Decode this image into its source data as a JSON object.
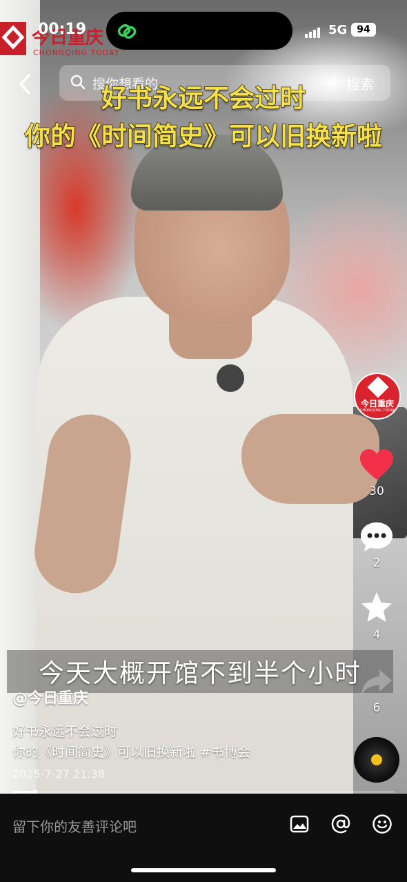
{
  "status": {
    "time": "00:19",
    "network": "5G",
    "battery": "94"
  },
  "watermark": {
    "name": "今日重庆",
    "sub": "CHONGQING TODAY"
  },
  "search": {
    "placeholder": "搜你想看的",
    "button": "搜索"
  },
  "captions": {
    "line1": "好书永远不会过时",
    "line2": "你的《时间简史》可以旧换新啦"
  },
  "subtitle": "今天大概开馆不到半个小时",
  "post": {
    "author": "@今日重庆",
    "desc_line1": "好书永远不会过时",
    "desc_line2": "你的《时间简史》可以旧换新啦 #书博会",
    "date": "2025-7-27 21:38",
    "progress": 0.06
  },
  "avatar": {
    "name": "今日重庆",
    "sub": "CHONGQING TODAY"
  },
  "actions": {
    "likes": "30",
    "comments": "2",
    "favorites": "4",
    "shares": "6"
  },
  "colors": {
    "like": "#f2304a",
    "caption": "#f4e04a",
    "brand": "#c8202b"
  },
  "comment_bar": {
    "placeholder": "留下你的友善评论吧"
  }
}
